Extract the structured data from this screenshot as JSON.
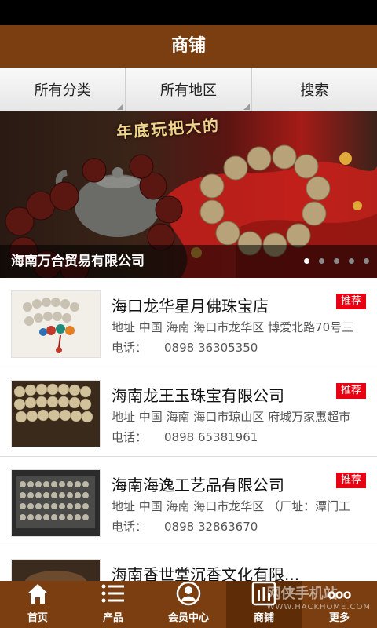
{
  "header": {
    "title": "商铺"
  },
  "filters": {
    "category": "所有分类",
    "region": "所有地区",
    "search": "搜索"
  },
  "banner": {
    "headline": "年底玩把大的",
    "caption": "海南万合贸易有限公司",
    "slide_count": 5,
    "active_slide": 1
  },
  "shops": [
    {
      "name": "海口龙华星月佛珠宝店",
      "tag": "推荐",
      "address": "地址  中国 海南 海口市龙华区 博爱北路70号三",
      "phone_label": "电话：",
      "phone": "0898 36305350"
    },
    {
      "name": "海南龙王玉珠宝有限公司",
      "tag": "推荐",
      "address": "地址  中国 海南 海口市琼山区 府城万家惠超市",
      "phone_label": "电话：",
      "phone": "0898 65381961"
    },
    {
      "name": "海南海逸工艺品有限公司",
      "tag": "推荐",
      "address": "地址  中国 海南 海口市龙华区 （厂址：潭门工",
      "phone_label": "电话：",
      "phone": "0898 32863670"
    },
    {
      "name": "海南香世堂沉香文化有限..."
    }
  ],
  "nav": {
    "home": "首页",
    "products": "产品",
    "member": "会员中心",
    "shops": "商铺",
    "more": "更多"
  },
  "watermark": {
    "text": "网侠手机站",
    "url": "WWW.HACKHOME.COM"
  },
  "colors": {
    "brand": "#7a3e10",
    "tag": "#e60012"
  }
}
